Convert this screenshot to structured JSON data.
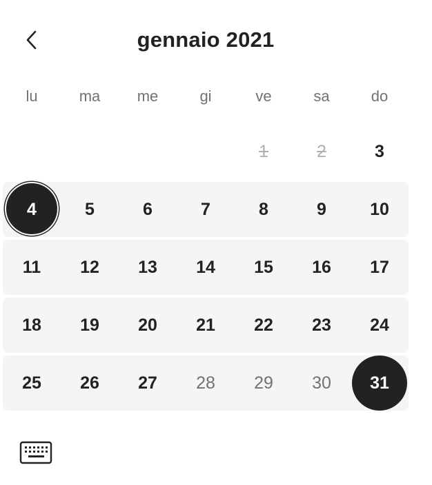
{
  "calendar": {
    "title": "gennaio 2021",
    "prev_icon": "chevron-left-icon",
    "keyboard_icon": "keyboard-icon",
    "weekdays": [
      "lu",
      "ma",
      "me",
      "gi",
      "ve",
      "sa",
      "do"
    ],
    "weeks": [
      [
        "",
        "",
        "",
        "",
        "1",
        "2",
        "3"
      ],
      [
        "4",
        "5",
        "6",
        "7",
        "8",
        "9",
        "10"
      ],
      [
        "11",
        "12",
        "13",
        "14",
        "15",
        "16",
        "17"
      ],
      [
        "18",
        "19",
        "20",
        "21",
        "22",
        "23",
        "24"
      ],
      [
        "25",
        "26",
        "27",
        "28",
        "29",
        "30",
        "31"
      ]
    ],
    "unavailable_days": [
      "1",
      "2"
    ],
    "muted_days": [
      "28",
      "29",
      "30"
    ],
    "selected_start": "4",
    "selected_end": "31"
  }
}
